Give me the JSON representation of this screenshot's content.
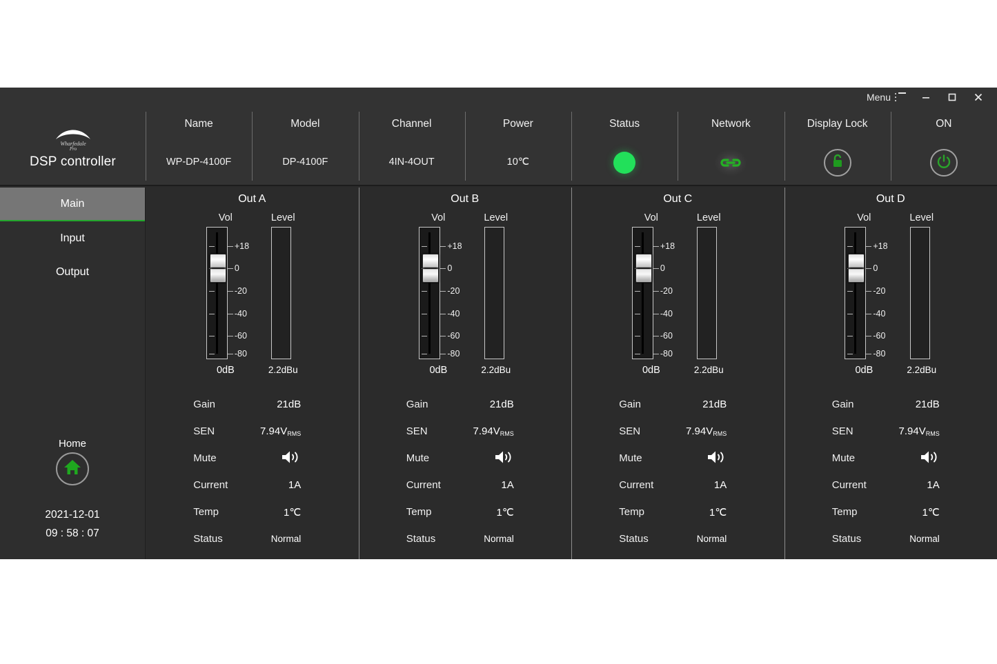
{
  "titlebar": {
    "menu_label": "Menu",
    "menu_icon": "list-menu-icon",
    "minimize_icon": "minimize-icon",
    "maximize_icon": "maximize-icon",
    "close_icon": "close-icon"
  },
  "brand": {
    "logo_icon": "wharfedale-pro-logo",
    "logo_text_top": "Wharfedale",
    "logo_text_bottom": "Pro",
    "app_title": "DSP controller"
  },
  "header": {
    "cells": [
      {
        "label": "Name",
        "value": "WP-DP-4100F"
      },
      {
        "label": "Model",
        "value": "DP-4100F"
      },
      {
        "label": "Channel",
        "value": "4IN-4OUT"
      },
      {
        "label": "Power",
        "value": "10℃"
      }
    ],
    "indicators": [
      {
        "label": "Status",
        "icon": "status-dot-icon",
        "state": "green"
      },
      {
        "label": "Network",
        "icon": "network-link-icon",
        "state": "green"
      },
      {
        "label": "Display Lock",
        "icon": "lock-icon",
        "state": "green"
      },
      {
        "label": "ON",
        "icon": "power-icon",
        "state": "green"
      }
    ]
  },
  "sidebar": {
    "items": [
      {
        "label": "Main",
        "active": true
      },
      {
        "label": "Input",
        "active": false
      },
      {
        "label": "Output",
        "active": false
      }
    ],
    "home_label": "Home",
    "home_icon": "home-icon",
    "date": "2021-12-01",
    "time": "09 : 58 : 07"
  },
  "meter_scale": {
    "vol_caption": "Vol",
    "level_caption": "Level",
    "labels": [
      "+18",
      "0",
      "-20",
      "-40",
      "-60",
      "-80"
    ],
    "label_positions_pct": [
      14.5,
      31.5,
      48.5,
      65.5,
      82.5,
      96.0
    ]
  },
  "channels": [
    {
      "title": "Out A",
      "fader_value": "0dB",
      "fader_pos_pct": 20.5,
      "level_value": "2.2dBu",
      "level_pct": 0,
      "params": [
        {
          "label": "Gain",
          "value": "21dB",
          "type": "text"
        },
        {
          "label": "SEN",
          "value": "7.94V",
          "sub": "RMS",
          "type": "sub"
        },
        {
          "label": "Mute",
          "value": "",
          "type": "icon",
          "icon": "speaker-on-icon"
        },
        {
          "label": "Current",
          "value": "1A",
          "type": "text"
        },
        {
          "label": "Temp",
          "value": "1℃",
          "type": "text"
        },
        {
          "label": "Status",
          "value": "Normal",
          "type": "small"
        }
      ]
    },
    {
      "title": "Out B",
      "fader_value": "0dB",
      "fader_pos_pct": 20.5,
      "level_value": "2.2dBu",
      "level_pct": 0,
      "params": [
        {
          "label": "Gain",
          "value": "21dB",
          "type": "text"
        },
        {
          "label": "SEN",
          "value": "7.94V",
          "sub": "RMS",
          "type": "sub"
        },
        {
          "label": "Mute",
          "value": "",
          "type": "icon",
          "icon": "speaker-on-icon"
        },
        {
          "label": "Current",
          "value": "1A",
          "type": "text"
        },
        {
          "label": "Temp",
          "value": "1℃",
          "type": "text"
        },
        {
          "label": "Status",
          "value": "Normal",
          "type": "small"
        }
      ]
    },
    {
      "title": "Out C",
      "fader_value": "0dB",
      "fader_pos_pct": 20.5,
      "level_value": "2.2dBu",
      "level_pct": 0,
      "params": [
        {
          "label": "Gain",
          "value": "21dB",
          "type": "text"
        },
        {
          "label": "SEN",
          "value": "7.94V",
          "sub": "RMS",
          "type": "sub"
        },
        {
          "label": "Mute",
          "value": "",
          "type": "icon",
          "icon": "speaker-on-icon"
        },
        {
          "label": "Current",
          "value": "1A",
          "type": "text"
        },
        {
          "label": "Temp",
          "value": "1℃",
          "type": "text"
        },
        {
          "label": "Status",
          "value": "Normal",
          "type": "small"
        }
      ]
    },
    {
      "title": "Out D",
      "fader_value": "0dB",
      "fader_pos_pct": 20.5,
      "level_value": "2.2dBu",
      "level_pct": 0,
      "params": [
        {
          "label": "Gain",
          "value": "21dB",
          "type": "text"
        },
        {
          "label": "SEN",
          "value": "7.94V",
          "sub": "RMS",
          "type": "sub"
        },
        {
          "label": "Mute",
          "value": "",
          "type": "icon",
          "icon": "speaker-on-icon"
        },
        {
          "label": "Current",
          "value": "1A",
          "type": "text"
        },
        {
          "label": "Temp",
          "value": "1℃",
          "type": "text"
        },
        {
          "label": "Status",
          "value": "Normal",
          "type": "small"
        }
      ]
    }
  ],
  "colors": {
    "accent_green": "#22a72c",
    "status_green": "#22e05a",
    "window_bg": "#2b2b2b",
    "header_bg": "#333333",
    "sidebar_active": "#767676"
  }
}
